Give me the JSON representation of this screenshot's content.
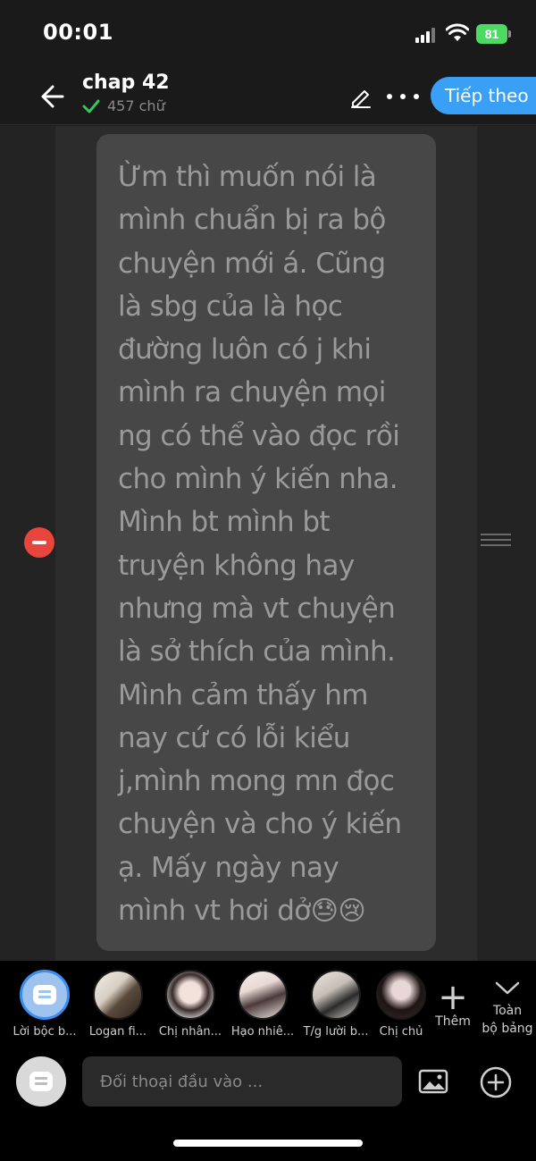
{
  "status": {
    "time": "00:01",
    "battery": "81"
  },
  "header": {
    "title": "chap 42",
    "word_count": "457 chữ",
    "next_label": "Tiếp theo"
  },
  "story": {
    "text": "Ừm thì muốn nói là\nmình chuẩn bị ra bộ\nchuyện mới á. Cũng\nlà sbg của là học\nđường luôn có j khi\nmình ra chuyện mọi\nng có thể vào đọc rồi\ncho mình ý kiến nha.\nMình bt mình bt\ntruyện không hay\nnhưng mà vt chuyện\nlà sở thích của mình.\nMình cảm thấy hm\nnay cứ có lỗi kiểu\nj,mình mong mn đọc\nchuyện và cho ý kiến\nạ. Mấy ngày nay\nmình vt hơi dở",
    "emojis": "😓😢"
  },
  "characters": [
    {
      "label": "Lời bộc b...",
      "icon": "narrator-bubble-icon"
    },
    {
      "label": "Logan fi...",
      "icon": "avatar"
    },
    {
      "label": "Chị nhân...",
      "icon": "avatar"
    },
    {
      "label": "Hạo nhiê...",
      "icon": "avatar"
    },
    {
      "label": "T/g lười b...",
      "icon": "avatar"
    },
    {
      "label": "Chị chủ",
      "icon": "avatar"
    }
  ],
  "toolbar": {
    "add_label": "Thêm",
    "full_board_label": "Toàn\nbộ bảng"
  },
  "input": {
    "placeholder": "Đối thoại đầu vào ..."
  }
}
